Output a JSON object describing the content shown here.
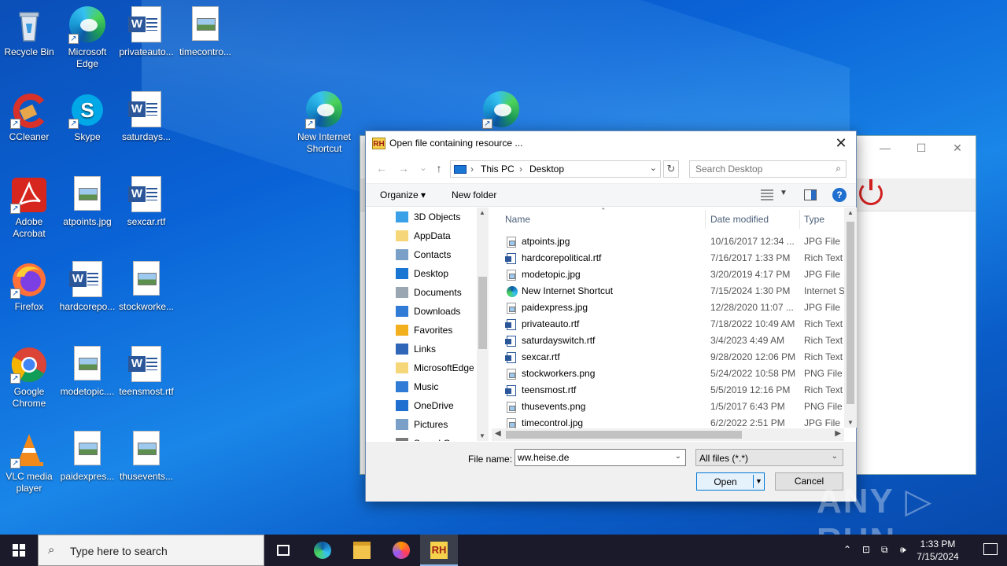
{
  "desktop": {
    "icons": [
      {
        "label": "Recycle Bin"
      },
      {
        "label": "Microsoft Edge"
      },
      {
        "label": "privateauto..."
      },
      {
        "label": "timecontro..."
      },
      {
        "label": "CCleaner"
      },
      {
        "label": "Skype"
      },
      {
        "label": "saturdays..."
      },
      {
        "label": "New Internet Shortcut"
      },
      {
        "label": "Adobe Acrobat"
      },
      {
        "label": "atpoints.jpg"
      },
      {
        "label": "sexcar.rtf"
      },
      {
        "label": "Firefox"
      },
      {
        "label": "hardcorepo..."
      },
      {
        "label": "stockworke..."
      },
      {
        "label": "Google Chrome"
      },
      {
        "label": "modetopic...."
      },
      {
        "label": "teensmost.rtf"
      },
      {
        "label": "VLC media player"
      },
      {
        "label": "paidexpres..."
      },
      {
        "label": "thusevents..."
      }
    ]
  },
  "dialog": {
    "title": "Open file containing resource ...",
    "badge": "RH",
    "close": "✕",
    "nav": {
      "back": "←",
      "forward": "→",
      "recent": "⌄",
      "up": "↑"
    },
    "address": {
      "crumb1": "This PC",
      "sep": "›",
      "crumb2": "Desktop",
      "sep0": "›"
    },
    "refresh": "↻",
    "search_placeholder": "Search Desktop",
    "search_icon": "⌕",
    "organize": "Organize ▾",
    "new_folder": "New folder",
    "help": "?",
    "tree": [
      {
        "label": "3D Objects",
        "icon": "cube-icon",
        "color": "#3aa0e8"
      },
      {
        "label": "AppData",
        "icon": "folder-icon",
        "color": "#f5d77a"
      },
      {
        "label": "Contacts",
        "icon": "contacts-icon",
        "color": "#7aa0c8"
      },
      {
        "label": "Desktop",
        "icon": "desktop-icon",
        "color": "#1976d2"
      },
      {
        "label": "Documents",
        "icon": "documents-icon",
        "color": "#9aa6b2"
      },
      {
        "label": "Downloads",
        "icon": "download-icon",
        "color": "#2f7bd6"
      },
      {
        "label": "Favorites",
        "icon": "star-icon",
        "color": "#f2b01e"
      },
      {
        "label": "Links",
        "icon": "link-icon",
        "color": "#2f66b8"
      },
      {
        "label": "MicrosoftEdge",
        "icon": "folder-icon",
        "color": "#f5d77a"
      },
      {
        "label": "Music",
        "icon": "music-icon",
        "color": "#2f7bd6"
      },
      {
        "label": "OneDrive",
        "icon": "cloud-icon",
        "color": "#1e6fd0"
      },
      {
        "label": "Pictures",
        "icon": "pictures-icon",
        "color": "#7aa0c8"
      },
      {
        "label": "Saved Games",
        "icon": "games-icon",
        "color": "#7a7a7a"
      }
    ],
    "columns": {
      "name": "Name",
      "date": "Date modified",
      "type": "Type"
    },
    "files": [
      {
        "name": "atpoints.jpg",
        "date": "10/16/2017 12:34 ...",
        "type": "JPG File",
        "kind": "img"
      },
      {
        "name": "hardcorepolitical.rtf",
        "date": "7/16/2017 1:33 PM",
        "type": "Rich Text",
        "kind": "rtf"
      },
      {
        "name": "modetopic.jpg",
        "date": "3/20/2019 4:17 PM",
        "type": "JPG File",
        "kind": "img"
      },
      {
        "name": "New Internet Shortcut",
        "date": "7/15/2024 1:30 PM",
        "type": "Internet S",
        "kind": "edge"
      },
      {
        "name": "paidexpress.jpg",
        "date": "12/28/2020 11:07 ...",
        "type": "JPG File",
        "kind": "img"
      },
      {
        "name": "privateauto.rtf",
        "date": "7/18/2022 10:49 AM",
        "type": "Rich Text",
        "kind": "rtf"
      },
      {
        "name": "saturdayswitch.rtf",
        "date": "3/4/2023 4:49 AM",
        "type": "Rich Text",
        "kind": "rtf"
      },
      {
        "name": "sexcar.rtf",
        "date": "9/28/2020 12:06 PM",
        "type": "Rich Text",
        "kind": "rtf"
      },
      {
        "name": "stockworkers.png",
        "date": "5/24/2022 10:58 PM",
        "type": "PNG File",
        "kind": "img"
      },
      {
        "name": "teensmost.rtf",
        "date": "5/5/2019 12:16 PM",
        "type": "Rich Text",
        "kind": "rtf"
      },
      {
        "name": "thusevents.png",
        "date": "1/5/2017 6:43 PM",
        "type": "PNG File",
        "kind": "img"
      },
      {
        "name": "timecontrol.jpg",
        "date": "6/2/2022 2:51 PM",
        "type": "JPG File",
        "kind": "img"
      }
    ],
    "file_name_label": "File name:",
    "file_name_value": "ww.heise.de",
    "filter_value": "All files (*.*)",
    "open_label": "Open",
    "cancel_label": "Cancel"
  },
  "watermark": "ANY ▷ RUN",
  "taskbar": {
    "search_placeholder": "Type here to search",
    "search_icon": "⌕",
    "rh_label": "RH",
    "time": "1:33 PM",
    "date": "7/15/2024",
    "tray_chevron": "⌃"
  },
  "bg_window": {
    "minimize": "—",
    "maximize": "☐",
    "close": "✕"
  }
}
